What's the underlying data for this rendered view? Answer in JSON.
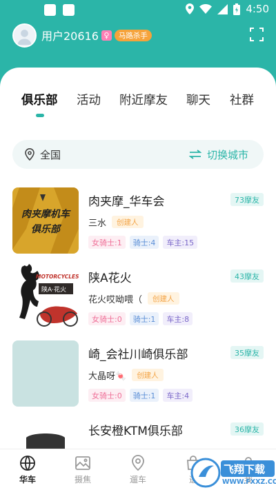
{
  "status_bar": {
    "time": "4:50"
  },
  "header": {
    "username": "用户20616",
    "gender_symbol": "♀",
    "title_badge": "马路杀手"
  },
  "tabs": [
    {
      "label": "俱乐部",
      "active": true
    },
    {
      "label": "活动",
      "active": false
    },
    {
      "label": "附近摩友",
      "active": false
    },
    {
      "label": "聊天",
      "active": false
    },
    {
      "label": "社群",
      "active": false
    }
  ],
  "city_bar": {
    "current": "全国",
    "switch_label": "切换城市"
  },
  "clubs": [
    {
      "name": "肉夹摩_华车会",
      "count": "73摩友",
      "creator": "三水",
      "creator_badge": "创建人",
      "female_riders": "女骑士:1",
      "riders": "骑士:4",
      "owners": "车主:15",
      "logo_text_line1": "肉夹摩机车",
      "logo_text_line2": "俱乐部"
    },
    {
      "name": "陕A花火",
      "count": "43摩友",
      "creator": "花火哎呦喂（",
      "creator_badge": "创建人",
      "female_riders": "女骑士:0",
      "riders": "骑士:1",
      "owners": "车主:8",
      "logo_text_line1": "MOTORCYCLES",
      "logo_text_line2": "陕A·花火"
    },
    {
      "name": "崎_会社川崎俱乐部",
      "count": "35摩友",
      "creator": "大晶呀🍬",
      "creator_badge": "创建人",
      "female_riders": "女骑士:0",
      "riders": "骑士:1",
      "owners": "车主:4"
    },
    {
      "name": "长安橙KTM俱乐部",
      "count": "36摩友"
    }
  ],
  "bottom_nav": [
    {
      "label": "华车",
      "icon": "globe-icon",
      "active": true
    },
    {
      "label": "摄焦",
      "icon": "image-icon",
      "active": false
    },
    {
      "label": "遛车",
      "icon": "map-pin-icon",
      "active": false
    },
    {
      "label": "逛",
      "icon": "shop-icon",
      "active": false
    },
    {
      "label": "我",
      "icon": "user-icon",
      "active": false
    }
  ],
  "watermark": {
    "text": "飞翔下载",
    "url": "WWW.FXXZ.COM"
  },
  "colors": {
    "accent": "#2bb5a8",
    "badge_orange": "#f6a33b"
  }
}
